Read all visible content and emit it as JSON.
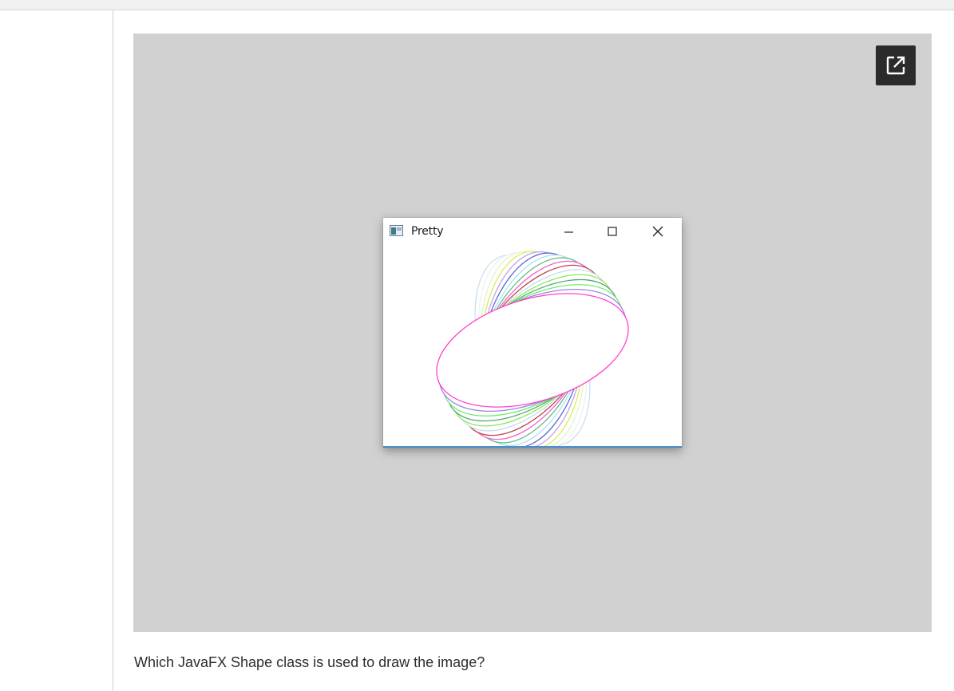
{
  "window": {
    "title": "Pretty",
    "icons": {
      "app": "app-window-icon",
      "minimize": "minimize-icon",
      "maximize": "maximize-icon",
      "close": "close-icon"
    }
  },
  "panel": {
    "expand_icon": "open-in-new-icon"
  },
  "question": {
    "text": "Which JavaFX Shape class is used to draw the image?"
  },
  "drawing": {
    "shape": "ellipse",
    "stroke_colors": [
      "#c8e0ee",
      "#f0f0f0",
      "#e0f5c8",
      "#d6f050",
      "#c8a0e8",
      "#5868d8",
      "#b0e0f0",
      "#60c080",
      "#f060d0",
      "#c04848",
      "#c8d8f0",
      "#88e858",
      "#58a870",
      "#68f068",
      "#a080e8",
      "#ff40d0"
    ]
  },
  "colors": {
    "panel_bg": "#d1d1d1",
    "expand_bg": "#2b2b2b"
  }
}
